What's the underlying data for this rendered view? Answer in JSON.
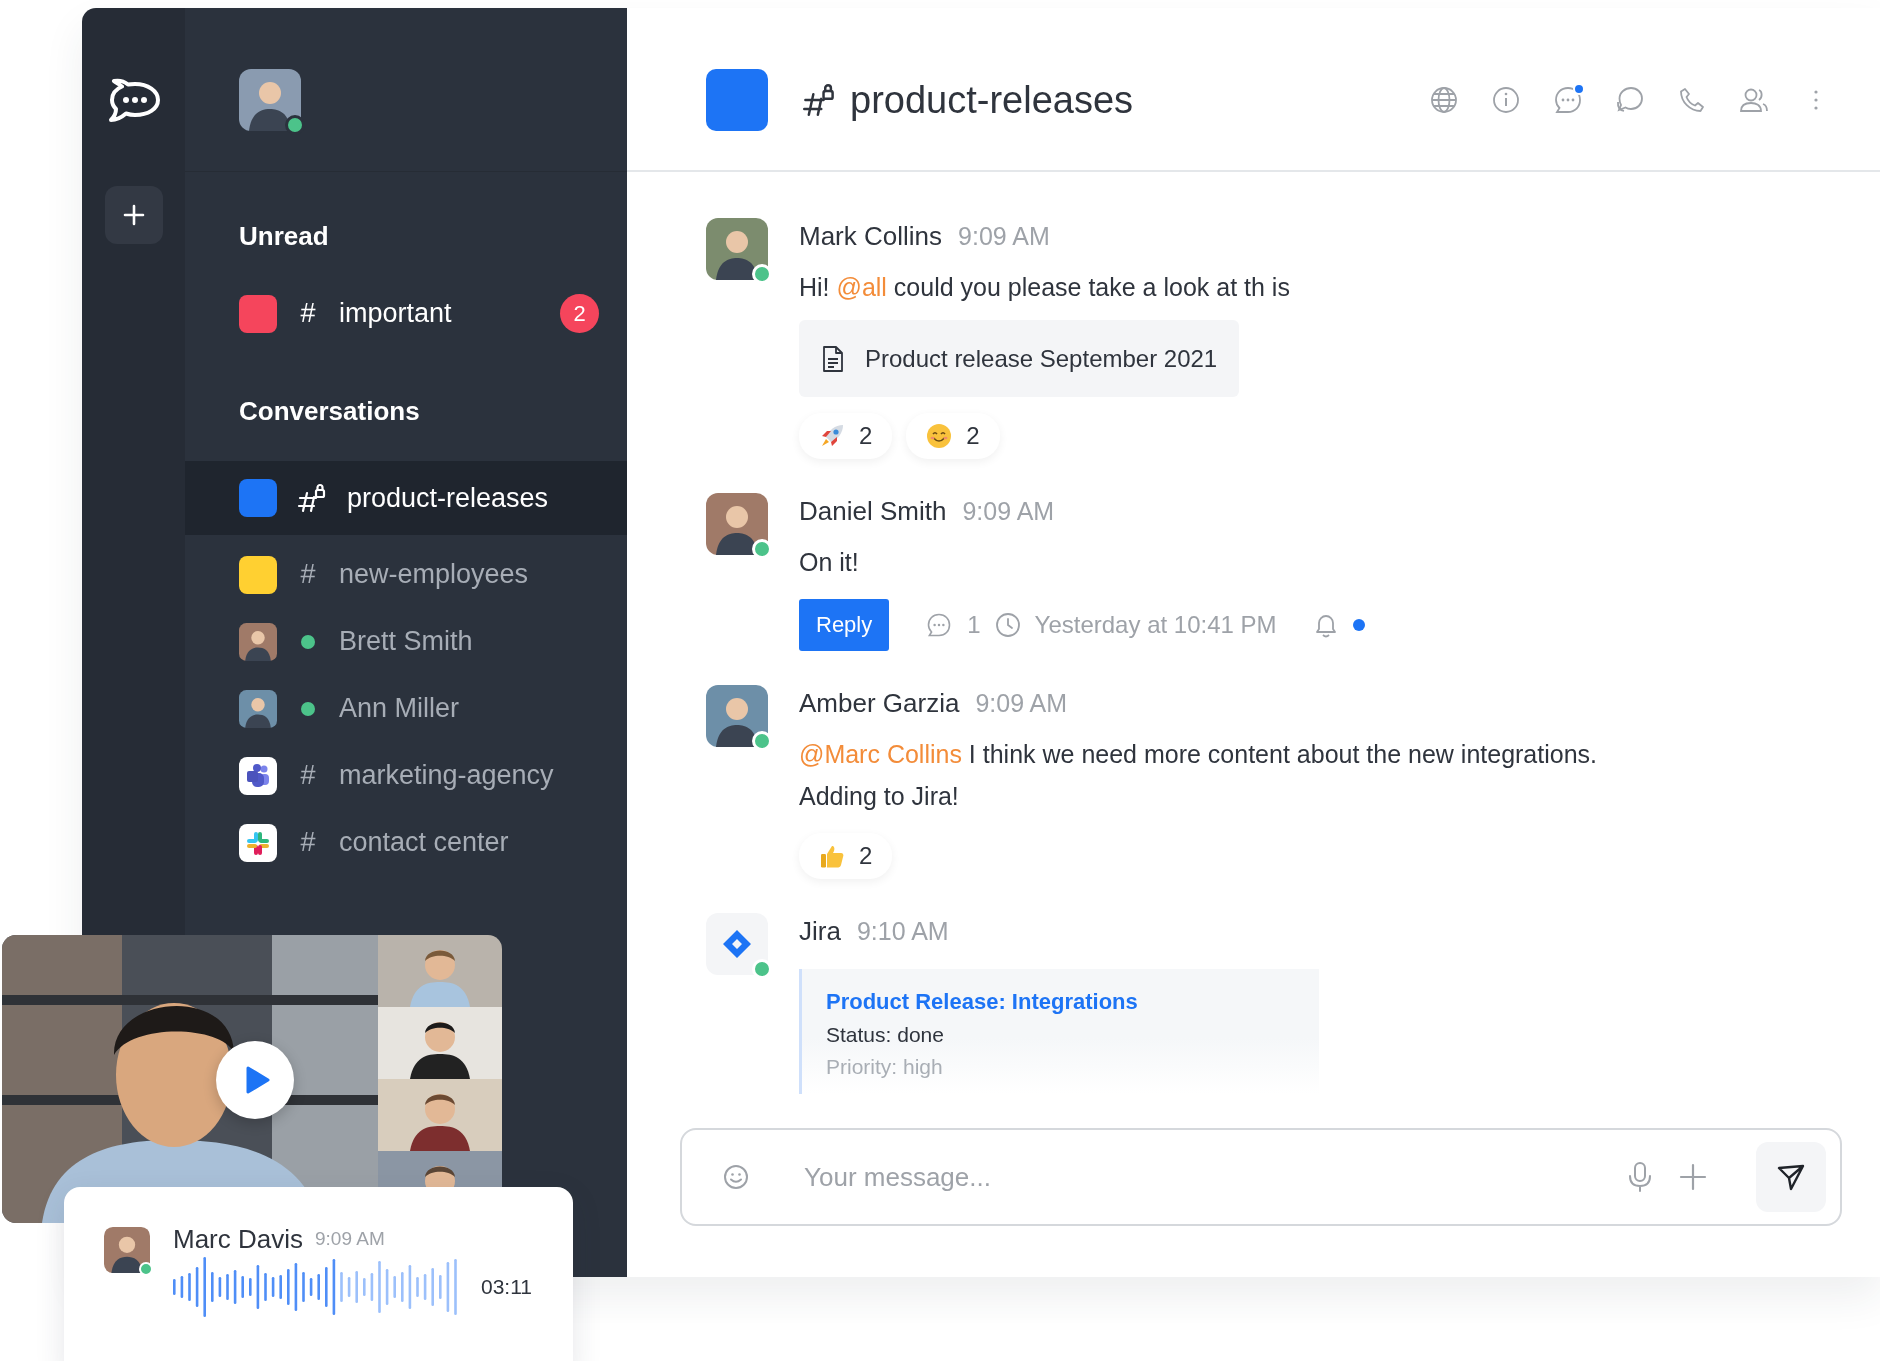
{
  "sidebar": {
    "sections": [
      {
        "title": "Unread",
        "items": [
          {
            "name": "important",
            "kind": "square",
            "color": "#f5455c",
            "prefix": "#",
            "private": false,
            "online": false,
            "unread": true,
            "selected": false,
            "badge": "2"
          }
        ]
      },
      {
        "title": "Conversations",
        "items": [
          {
            "name": "product-releases",
            "kind": "square",
            "color": "#1d74f5",
            "private": true,
            "online": false,
            "unread": false,
            "selected": true
          },
          {
            "name": "new-employees",
            "kind": "square",
            "color": "#ffd031",
            "prefix": "#",
            "private": false,
            "online": false,
            "unread": false,
            "selected": false
          },
          {
            "name": "Brett Smith",
            "kind": "avatar",
            "private": false,
            "online": true,
            "unread": false,
            "selected": false
          },
          {
            "name": "Ann Miller",
            "kind": "avatar",
            "private": false,
            "online": true,
            "unread": false,
            "selected": false
          },
          {
            "name": "marketing-agency",
            "kind": "teams",
            "prefix": "#",
            "private": false,
            "online": false,
            "unread": false,
            "selected": false
          },
          {
            "name": "contact center",
            "kind": "pinwheel",
            "prefix": "#",
            "private": false,
            "online": false,
            "unread": false,
            "selected": false
          }
        ]
      }
    ]
  },
  "header": {
    "title": "product-releases",
    "color": "#1d74f5",
    "private": true,
    "icons": [
      {
        "kind": "globe",
        "dot": false
      },
      {
        "kind": "info",
        "dot": false
      },
      {
        "kind": "threads",
        "dot": true
      },
      {
        "kind": "discussion",
        "dot": false
      },
      {
        "kind": "call",
        "dot": false
      },
      {
        "kind": "members",
        "dot": false
      },
      {
        "kind": "kebab",
        "dot": false
      }
    ]
  },
  "messages": [
    {
      "author": "Mark Collins",
      "time": "9:09 AM",
      "kind": "person",
      "online": true,
      "lines": [
        [
          {
            "text": "Hi! ",
            "mention": false
          },
          {
            "text": "@all",
            "mention": true
          },
          {
            "text": " could you please take a look at th is",
            "mention": false
          }
        ]
      ],
      "file": "Product release September 2021",
      "reactions": [
        {
          "kind": "rocket",
          "count": "2"
        },
        {
          "kind": "smile",
          "count": "2"
        }
      ]
    },
    {
      "author": "Daniel Smith",
      "time": "9:09 AM",
      "kind": "person",
      "online": true,
      "lines": [
        [
          {
            "text": "On it!",
            "mention": false
          }
        ]
      ],
      "thread": {
        "reply": "Reply",
        "replies": "1",
        "last_reply": "Yesterday at 10:41 PM",
        "unread": true
      }
    },
    {
      "author": "Amber Garzia",
      "time": "9:09 AM",
      "kind": "person",
      "online": true,
      "lines": [
        [
          {
            "text": "@Marc Collins",
            "mention": true
          },
          {
            "text": " I think we need more content about the new integrations.",
            "mention": false
          }
        ],
        [
          {
            "text": "Adding to Jira!",
            "mention": false
          }
        ]
      ],
      "reactions": [
        {
          "kind": "thumbs_up",
          "count": "2"
        }
      ]
    },
    {
      "author": "Jira",
      "time": "9:10 AM",
      "kind": "app",
      "online": true,
      "card": {
        "title": "Product Release: Integrations",
        "fields": [
          "Status: done",
          "Priority: high"
        ]
      }
    }
  ],
  "composer": {
    "placeholder": "Your message..."
  },
  "voice_message": {
    "author": "Marc Davis",
    "time": "9:09 AM",
    "online": true,
    "duration": "03:11"
  }
}
